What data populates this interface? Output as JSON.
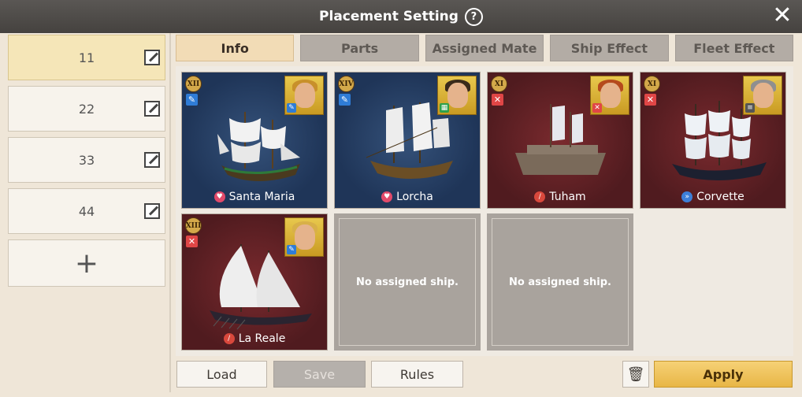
{
  "window": {
    "title": "Placement Setting",
    "help_glyph": "?",
    "close_glyph": "✕"
  },
  "sidebar": {
    "fleets": [
      {
        "label": "11",
        "active": true
      },
      {
        "label": "22",
        "active": false
      },
      {
        "label": "33",
        "active": false
      },
      {
        "label": "44",
        "active": false
      }
    ],
    "add_glyph": "+"
  },
  "tabs": [
    {
      "label": "Info",
      "active": true
    },
    {
      "label": "Parts",
      "active": false
    },
    {
      "label": "Assigned Mate",
      "active": false
    },
    {
      "label": "Ship Effect",
      "active": false
    },
    {
      "label": "Fleet Effect",
      "active": false
    }
  ],
  "ships": [
    {
      "name": "Santa Maria",
      "rank": "XII",
      "theme": "blue",
      "role": "blue",
      "role_glyph": "✎",
      "type_color": "#e24a6a",
      "type_glyph": "♥",
      "mate_hair": "#c8902a"
    },
    {
      "name": "Lorcha",
      "rank": "XIV",
      "theme": "blue",
      "role": "blue",
      "role_glyph": "✎",
      "type_color": "#e24a6a",
      "type_glyph": "♥",
      "mate_hair": "#3a2a1a"
    },
    {
      "name": "Tuham",
      "rank": "XI",
      "theme": "red",
      "role": "red",
      "role_glyph": "✕",
      "type_color": "#d9483c",
      "type_glyph": "/",
      "mate_hair": "#b54a1c"
    },
    {
      "name": "Corvette",
      "rank": "XI",
      "theme": "red",
      "role": "red",
      "role_glyph": "✕",
      "type_color": "#3d7fd8",
      "type_glyph": "»",
      "mate_hair": "#8f8f8f"
    },
    {
      "name": "La Reale",
      "rank": "XIII",
      "theme": "red",
      "role": "red",
      "role_glyph": "✕",
      "type_color": "#d9483c",
      "type_glyph": "/",
      "mate_hair": "#d8b048"
    }
  ],
  "empty_slots": [
    {
      "text": "No assigned ship."
    },
    {
      "text": "No assigned ship."
    }
  ],
  "buttons": {
    "load": "Load",
    "save": "Save",
    "rules": "Rules",
    "trash_glyph": "🗑",
    "apply": "Apply"
  }
}
